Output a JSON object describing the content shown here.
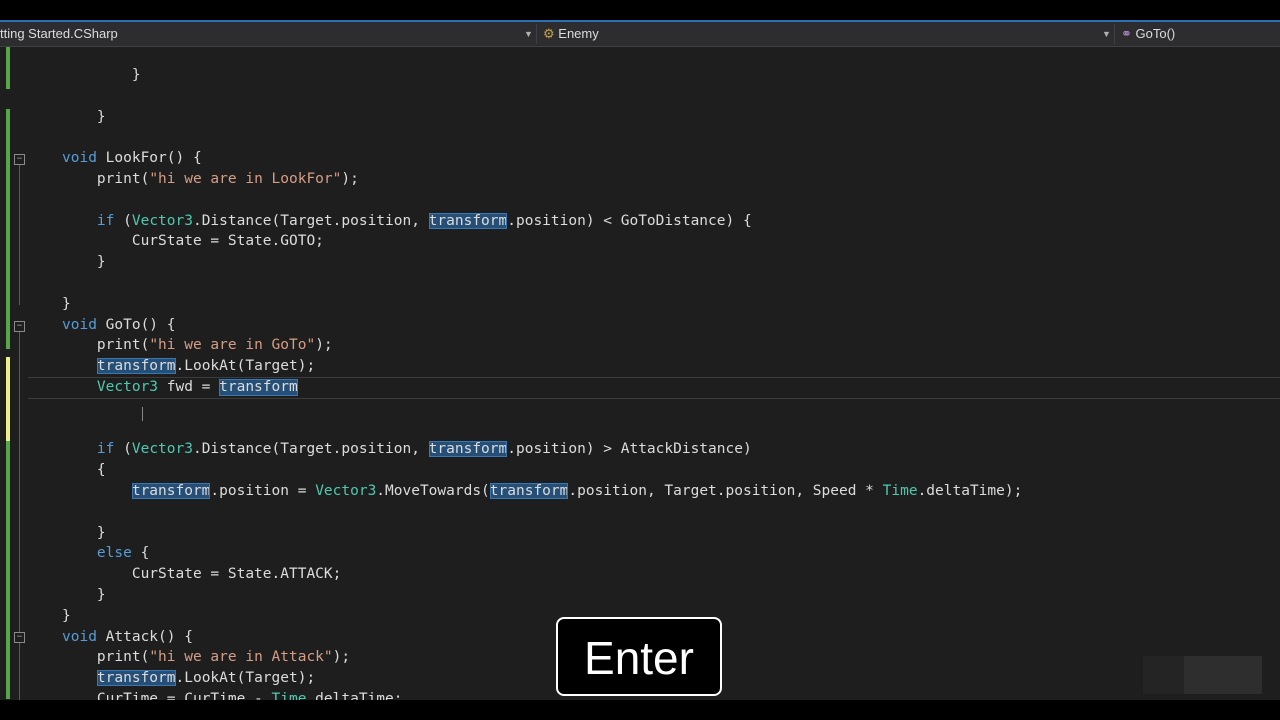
{
  "navbar": {
    "project": "tting Started.CSharp",
    "class_name": "Enemy",
    "member": "GoTo()"
  },
  "code": {
    "l01": "}",
    "l02": "}",
    "l03_kw": "void",
    "l03_rest": " LookFor() {",
    "l04_a": "print(",
    "l04_str": "\"hi we are in LookFor\"",
    "l04_b": ");",
    "l05_kw": "if",
    "l05_a": " (",
    "l05_type": "Vector3",
    "l05_b": ".Distance(Target.position, ",
    "l05_hl": "transform",
    "l05_c": ".position) < GoToDistance) {",
    "l06": "CurState = State.GOTO;",
    "l07": "}",
    "l08": "}",
    "l09_kw": "void",
    "l09_rest": " GoTo() {",
    "l10_a": "print(",
    "l10_str": "\"hi we are in GoTo\"",
    "l10_b": ");",
    "l11_hl": "transform",
    "l11_rest": ".LookAt(Target);",
    "l12_type": "Vector3",
    "l12_a": " fwd = ",
    "l12_hl": "transform",
    "l13_kw": "if",
    "l13_a": " (",
    "l13_type": "Vector3",
    "l13_b": ".Distance(Target.position, ",
    "l13_hl": "transform",
    "l13_c": ".position) > AttackDistance)",
    "l14": "{",
    "l15_hl1": "transform",
    "l15_a": ".position = ",
    "l15_type": "Vector3",
    "l15_b": ".MoveTowards(",
    "l15_hl2": "transform",
    "l15_c": ".position, Target.position, Speed * ",
    "l15_type2": "Time",
    "l15_d": ".deltaTime);",
    "l16": "}",
    "l17_kw": "else",
    "l17_rest": " {",
    "l18": "CurState = State.ATTACK;",
    "l19": "}",
    "l20": "}",
    "l21_kw": "void",
    "l21_rest": " Attack() {",
    "l22_a": "print(",
    "l22_str": "\"hi we are in Attack\"",
    "l22_b": ");",
    "l23_hl": "transform",
    "l23_rest": ".LookAt(Target);",
    "l24_a": "CurTime = CurTime - ",
    "l24_type": "Time",
    "l24_b": ".deltaTime;"
  },
  "overlay": {
    "key_label": "Enter"
  }
}
